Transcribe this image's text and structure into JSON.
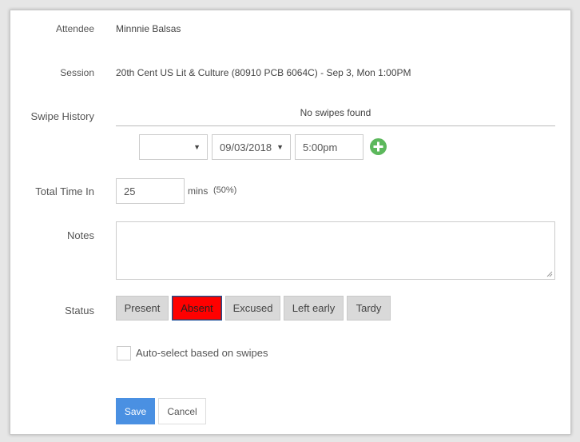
{
  "attendee": {
    "label": "Attendee",
    "value": "Minnnie Balsas"
  },
  "session": {
    "label": "Session",
    "value": "20th Cent US Lit & Culture (80910 PCB 6064C) - Sep 3, Mon 1:00PM"
  },
  "swipe_history": {
    "label": "Swipe History",
    "empty_text": "No swipes found",
    "type_select": "",
    "date_select": "09/03/2018",
    "time_input": "5:00pm",
    "add_icon": "plus-circle-icon"
  },
  "total_time": {
    "label": "Total Time In",
    "value": "25",
    "unit": "mins",
    "percent": "(50%)"
  },
  "notes": {
    "label": "Notes",
    "value": ""
  },
  "status": {
    "label": "Status",
    "options": [
      "Present",
      "Absent",
      "Excused",
      "Left early",
      "Tardy"
    ],
    "selected": "Absent",
    "selected_color": "#ff0000"
  },
  "auto_select": {
    "label": "Auto-select based on swipes",
    "checked": false
  },
  "actions": {
    "save_label": "Save",
    "cancel_label": "Cancel",
    "save_color": "#4a90e2"
  }
}
